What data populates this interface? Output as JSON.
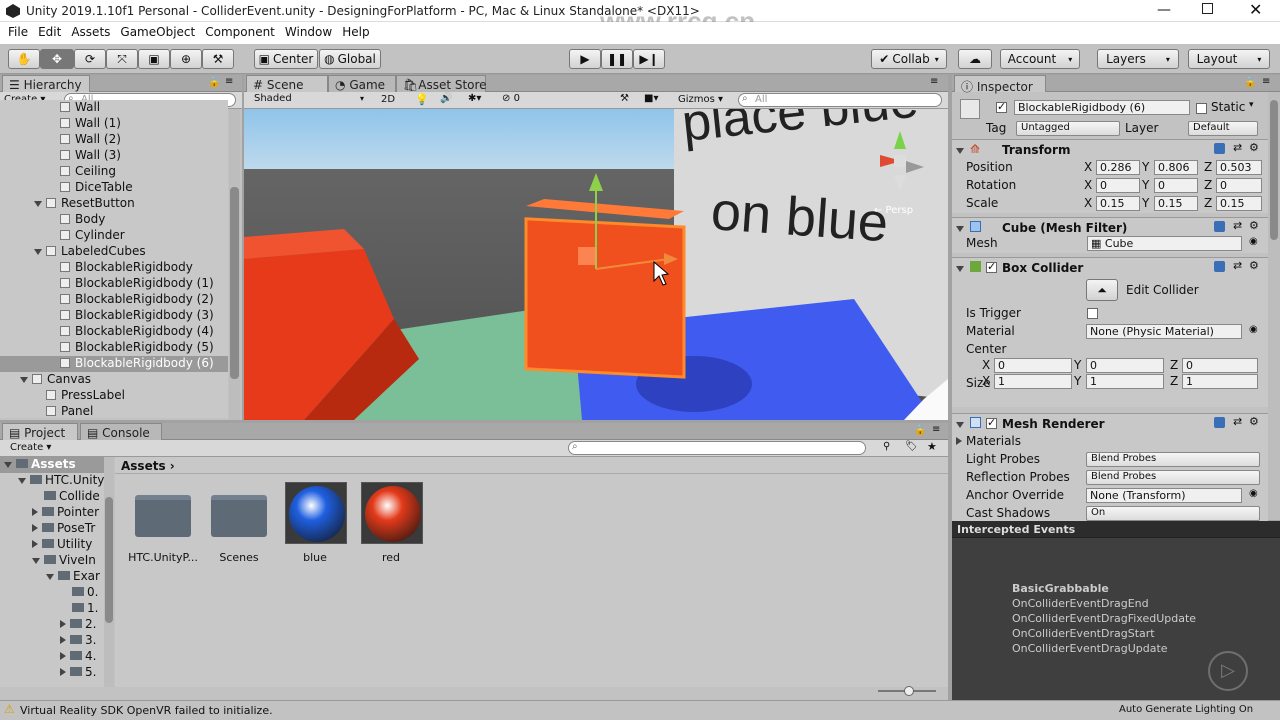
{
  "window": {
    "title": "Unity 2019.1.10f1 Personal - ColliderEvent.unity - DesigningForPlatform - PC, Mac & Linux Standalone* <DX11>"
  },
  "menu": [
    "File",
    "Edit",
    "Assets",
    "GameObject",
    "Component",
    "Window",
    "Help"
  ],
  "toolbar": {
    "center": "Center",
    "global": "Global",
    "collab": "Collab",
    "account": "Account",
    "layers": "Layers",
    "layout": "Layout"
  },
  "hierarchy": {
    "tab": "Hierarchy",
    "create": "Create",
    "search_placeholder": "All",
    "rows": [
      {
        "label": "Wall",
        "depth": 2
      },
      {
        "label": "Wall (1)",
        "depth": 2
      },
      {
        "label": "Wall (2)",
        "depth": 2
      },
      {
        "label": "Wall (3)",
        "depth": 2
      },
      {
        "label": "Ceiling",
        "depth": 2
      },
      {
        "label": "DiceTable",
        "depth": 2
      },
      {
        "label": "ResetButton",
        "depth": 1
      },
      {
        "label": "Body",
        "depth": 2
      },
      {
        "label": "Cylinder",
        "depth": 2
      },
      {
        "label": "LabeledCubes",
        "depth": 1
      },
      {
        "label": "BlockableRigidbody",
        "depth": 2
      },
      {
        "label": "BlockableRigidbody (1)",
        "depth": 2
      },
      {
        "label": "BlockableRigidbody (2)",
        "depth": 2
      },
      {
        "label": "BlockableRigidbody (3)",
        "depth": 2
      },
      {
        "label": "BlockableRigidbody (4)",
        "depth": 2
      },
      {
        "label": "BlockableRigidbody (5)",
        "depth": 2
      },
      {
        "label": "BlockableRigidbody (6)",
        "depth": 2
      },
      {
        "label": "Canvas",
        "depth": 0
      },
      {
        "label": "PressLabel",
        "depth": 1
      },
      {
        "label": "Panel",
        "depth": 1
      }
    ]
  },
  "scene": {
    "tabs": [
      "Scene",
      "Game",
      "Asset Store"
    ],
    "shading": "Shaded",
    "mode2d": "2D",
    "gizmos": "Gizmos",
    "search_placeholder": "All",
    "hidden_count": "0",
    "wall_text_1": "place blue",
    "wall_text_2": "on blue",
    "persp": "← Persp"
  },
  "inspector": {
    "tab": "Inspector",
    "object_name": "BlockableRigidbody (6)",
    "static_label": "Static",
    "tag_label": "Tag",
    "tag": "Untagged",
    "layer_label": "Layer",
    "layer": "Default",
    "transform": {
      "title": "Transform",
      "position": {
        "label": "Position",
        "x": "0.286",
        "y": "0.806",
        "z": "0.503"
      },
      "rotation": {
        "label": "Rotation",
        "x": "0",
        "y": "0",
        "z": "0"
      },
      "scale": {
        "label": "Scale",
        "x": "0.15",
        "y": "0.15",
        "z": "0.15"
      }
    },
    "mesh_filter": {
      "title": "Cube (Mesh Filter)",
      "mesh_label": "Mesh",
      "mesh": "Cube"
    },
    "box_collider": {
      "title": "Box Collider",
      "edit": "Edit Collider",
      "is_trigger": "Is Trigger",
      "material_label": "Material",
      "material": "None (Physic Material)",
      "center_label": "Center",
      "center": {
        "x": "0",
        "y": "0",
        "z": "0"
      },
      "size_label": "Size",
      "size": {
        "x": "1",
        "y": "1",
        "z": "1"
      }
    },
    "mesh_renderer": {
      "title": "Mesh Renderer",
      "materials": "Materials",
      "light_probes_label": "Light Probes",
      "light_probes": "Blend Probes",
      "reflection_probes_label": "Reflection Probes",
      "reflection_probes": "Blend Probes",
      "anchor_label": "Anchor Override",
      "anchor": "None (Transform)",
      "cast_shadows_label": "Cast Shadows",
      "cast_shadows": "On"
    }
  },
  "events": {
    "title": "Intercepted Events",
    "header": "BasicGrabbable",
    "items": [
      "OnColliderEventDragEnd",
      "OnColliderEventDragFixedUpdate",
      "OnColliderEventDragStart",
      "OnColliderEventDragUpdate"
    ]
  },
  "project": {
    "tabs": [
      "Project",
      "Console"
    ],
    "create": "Create",
    "breadcrumb": "Assets",
    "tree": [
      {
        "label": "Assets",
        "depth": 0,
        "bold": true
      },
      {
        "label": "HTC.Unity",
        "depth": 1
      },
      {
        "label": "Collide",
        "depth": 2
      },
      {
        "label": "Pointer",
        "depth": 2
      },
      {
        "label": "PoseTr",
        "depth": 2
      },
      {
        "label": "Utility",
        "depth": 2
      },
      {
        "label": "ViveIn",
        "depth": 2
      },
      {
        "label": "Exar",
        "depth": 3
      },
      {
        "label": "0.",
        "depth": 4
      },
      {
        "label": "1.",
        "depth": 4
      },
      {
        "label": "2.",
        "depth": 4
      },
      {
        "label": "3.",
        "depth": 4
      },
      {
        "label": "4.",
        "depth": 4
      },
      {
        "label": "5.",
        "depth": 4
      }
    ],
    "items": [
      {
        "label": "HTC.UnityP...",
        "kind": "folder"
      },
      {
        "label": "Scenes",
        "kind": "folder"
      },
      {
        "label": "blue",
        "kind": "material",
        "color": "#1f5fe0"
      },
      {
        "label": "red",
        "kind": "material",
        "color": "#e33a1a"
      }
    ]
  },
  "status": {
    "message": "Virtual Reality SDK OpenVR failed to initialize.",
    "right": "Auto Generate Lighting On"
  },
  "watermark": "www.rrcg.cn"
}
